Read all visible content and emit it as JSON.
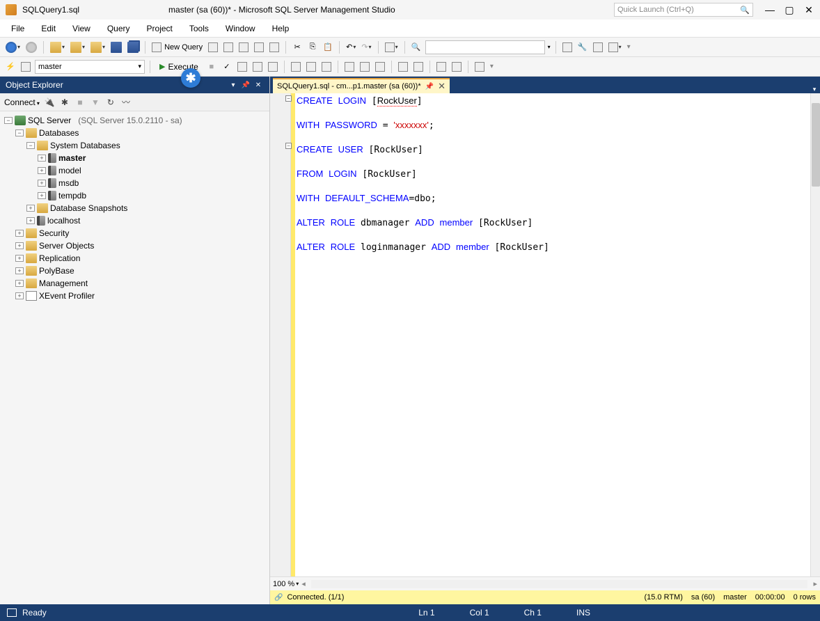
{
  "title_bar": {
    "doc_name": "SQLQuery1.sql",
    "title": "master (sa (60))* - Microsoft SQL Server Management Studio",
    "quick_launch_placeholder": "Quick Launch (Ctrl+Q)"
  },
  "menu": [
    "File",
    "Edit",
    "View",
    "Query",
    "Project",
    "Tools",
    "Window",
    "Help"
  ],
  "toolbar1": {
    "new_query": "New Query"
  },
  "toolbar2": {
    "db_combo": "master",
    "execute": "Execute"
  },
  "object_explorer": {
    "title": "Object Explorer",
    "connect": "Connect",
    "tree": {
      "server": "SQL Server",
      "server_info": "(SQL Server 15.0.2110 - sa)",
      "databases": "Databases",
      "system_databases": "System Databases",
      "dbs": [
        "master",
        "model",
        "msdb",
        "tempdb"
      ],
      "snapshots": "Database Snapshots",
      "localhost": "localhost",
      "security": "Security",
      "server_objects": "Server Objects",
      "replication": "Replication",
      "polybase": "PolyBase",
      "management": "Management",
      "xevent": "XEvent Profiler"
    }
  },
  "editor": {
    "tab_label": "SQLQuery1.sql - cm...p1.master (sa (60))*",
    "zoom": "100 %",
    "code_lines": [
      {
        "t": [
          {
            "c": "kw",
            "v": "CREATE"
          },
          {
            "c": "",
            "v": " "
          },
          {
            "c": "kw",
            "v": "LOGIN"
          },
          {
            "c": "",
            "v": " ["
          },
          {
            "c": "err",
            "v": "RockUser"
          },
          {
            "c": "",
            "v": "]"
          }
        ]
      },
      {
        "t": []
      },
      {
        "t": [
          {
            "c": "kw",
            "v": "WITH"
          },
          {
            "c": "",
            "v": " "
          },
          {
            "c": "kw",
            "v": "PASSWORD"
          },
          {
            "c": "",
            "v": " = "
          },
          {
            "c": "str",
            "v": "'xxxxxxx'"
          },
          {
            "c": "",
            "v": ";"
          }
        ]
      },
      {
        "t": []
      },
      {
        "t": [
          {
            "c": "kw",
            "v": "CREATE"
          },
          {
            "c": "",
            "v": " "
          },
          {
            "c": "kw",
            "v": "USER"
          },
          {
            "c": "",
            "v": " [RockUser]"
          }
        ]
      },
      {
        "t": []
      },
      {
        "t": [
          {
            "c": "kw",
            "v": "FROM"
          },
          {
            "c": "",
            "v": " "
          },
          {
            "c": "kw",
            "v": "LOGIN"
          },
          {
            "c": "",
            "v": " [RockUser]"
          }
        ]
      },
      {
        "t": []
      },
      {
        "t": [
          {
            "c": "kw",
            "v": "WITH"
          },
          {
            "c": "",
            "v": " "
          },
          {
            "c": "kw",
            "v": "DEFAULT_SCHEMA"
          },
          {
            "c": "",
            "v": "=dbo;"
          }
        ]
      },
      {
        "t": []
      },
      {
        "t": [
          {
            "c": "kw",
            "v": "ALTER"
          },
          {
            "c": "",
            "v": " "
          },
          {
            "c": "kw",
            "v": "ROLE"
          },
          {
            "c": "",
            "v": " dbmanager "
          },
          {
            "c": "kw",
            "v": "ADD"
          },
          {
            "c": "",
            "v": " "
          },
          {
            "c": "kw",
            "v": "member"
          },
          {
            "c": "",
            "v": " [RockUser]"
          }
        ]
      },
      {
        "t": []
      },
      {
        "t": [
          {
            "c": "kw",
            "v": "ALTER"
          },
          {
            "c": "",
            "v": " "
          },
          {
            "c": "kw",
            "v": "ROLE"
          },
          {
            "c": "",
            "v": " loginmanager "
          },
          {
            "c": "kw",
            "v": "ADD"
          },
          {
            "c": "",
            "v": " "
          },
          {
            "c": "kw",
            "v": "member"
          },
          {
            "c": "",
            "v": " [RockUser]"
          }
        ]
      }
    ]
  },
  "conn_status": {
    "left": "Connected. (1/1)",
    "right": [
      "(15.0 RTM)",
      "sa (60)",
      "master",
      "00:00:00",
      "0 rows"
    ]
  },
  "status_bar": {
    "ready": "Ready",
    "pos": [
      "Ln 1",
      "Col 1",
      "Ch 1",
      "INS"
    ]
  }
}
